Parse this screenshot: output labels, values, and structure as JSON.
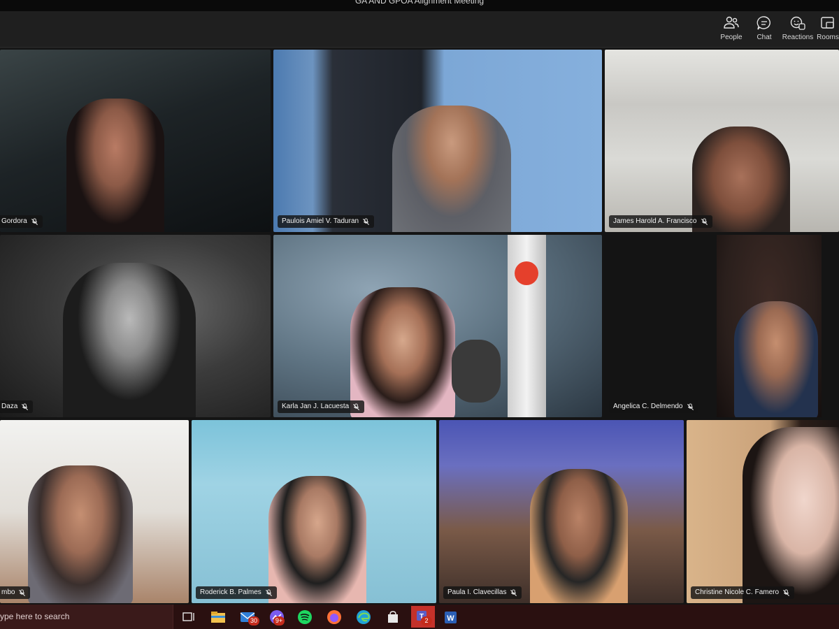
{
  "window": {
    "title": "GA AND GPOA Alignment Meeting"
  },
  "toolbar": {
    "buttons": [
      {
        "label": "People",
        "icon": "people-icon"
      },
      {
        "label": "Chat",
        "icon": "chat-icon"
      },
      {
        "label": "Reactions",
        "icon": "reactions-icon"
      },
      {
        "label": "Rooms",
        "icon": "rooms-icon"
      }
    ]
  },
  "participants": [
    {
      "name": "Gordora",
      "muted": true
    },
    {
      "name": "Paulois Amiel V. Taduran",
      "muted": true
    },
    {
      "name": "James Harold A. Francisco",
      "muted": true
    },
    {
      "name": "Daza",
      "muted": true
    },
    {
      "name": "Karla Jan J. Lacuesta",
      "muted": true
    },
    {
      "name": "Angelica C. Delmendo",
      "muted": true
    },
    {
      "name": "mbo",
      "muted": true
    },
    {
      "name": "Roderick B. Palmes",
      "muted": true
    },
    {
      "name": "Paula I. Clavecillas",
      "muted": true
    },
    {
      "name": "Christine Nicole C. Famero",
      "muted": true
    }
  ],
  "taskbar": {
    "search_placeholder": "ype here to search",
    "apps": [
      {
        "icon": "task-view-icon"
      },
      {
        "icon": "file-explorer-icon"
      },
      {
        "icon": "mail-icon",
        "badge": "30"
      },
      {
        "icon": "messenger-icon",
        "badge": "9+"
      },
      {
        "icon": "spotify-icon"
      },
      {
        "icon": "firefox-icon"
      },
      {
        "icon": "edge-icon"
      },
      {
        "icon": "store-icon"
      },
      {
        "icon": "teams-icon",
        "badge": "2"
      },
      {
        "icon": "word-icon"
      }
    ]
  },
  "colors": {
    "taskbar": "#2a1010",
    "teams_accent": "#c4312a",
    "toolbar_bg": "#1f1f1f"
  }
}
